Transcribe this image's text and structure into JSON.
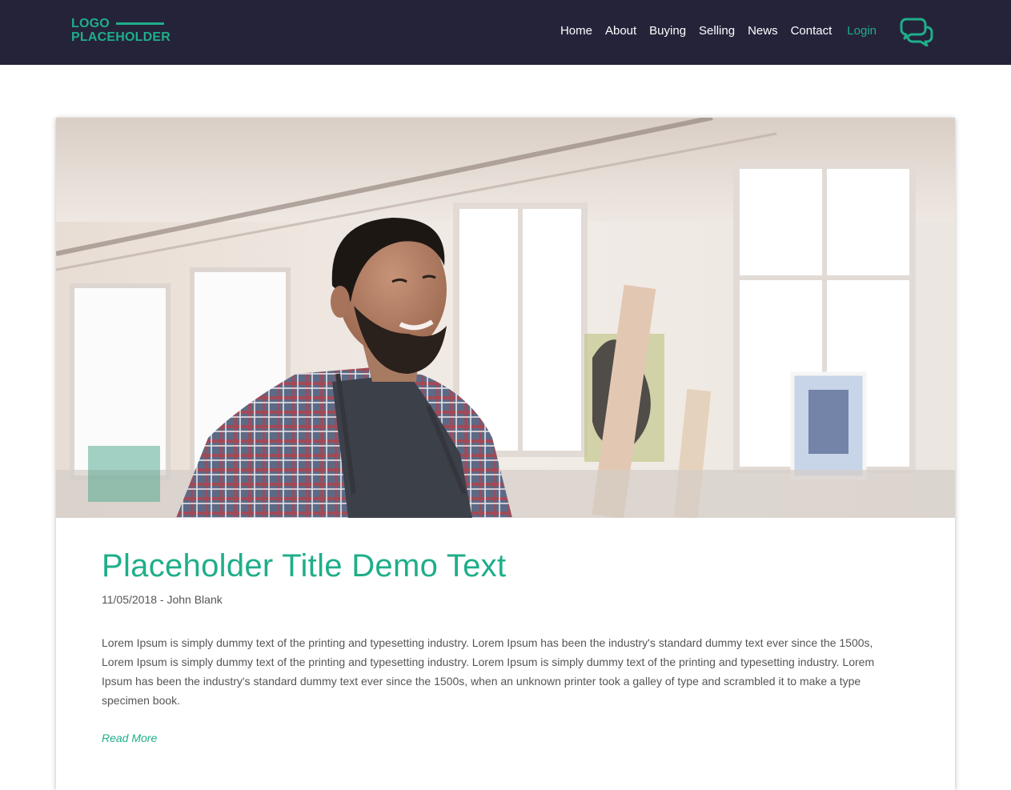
{
  "header": {
    "logo_line1": "LOGO",
    "logo_line2": "PLACEHOLDER",
    "nav": [
      "Home",
      "About",
      "Buying",
      "Selling",
      "News",
      "Contact"
    ],
    "login": "Login",
    "chat_icon": "chat-bubbles-icon"
  },
  "article": {
    "title": "Placeholder Title Demo Text",
    "meta": "11/05/2018 - John Blank",
    "body": "Lorem Ipsum is simply dummy text of the printing and typesetting industry. Lorem Ipsum has been the industry's standard dummy text ever since the 1500s, Lorem Ipsum is simply dummy text of the printing and typesetting industry. Lorem Ipsum is simply dummy text of the printing and typesetting industry. Lorem Ipsum has been the industry's standard dummy text ever since the 1500s, when an unknown printer took a galley of type and scrambled it to make a type specimen book.",
    "read_more": "Read More"
  },
  "colors": {
    "nav_bg": "#25233a",
    "accent": "#1fae8a",
    "text": "#555555"
  }
}
